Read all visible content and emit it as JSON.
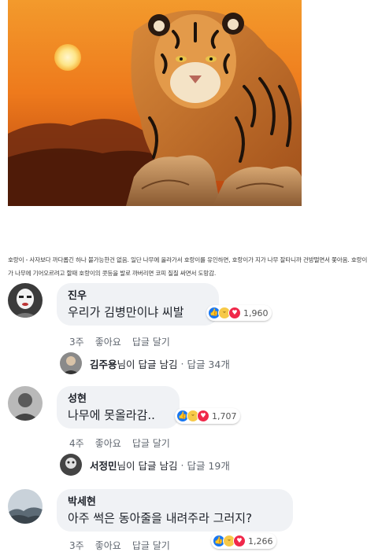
{
  "post": {
    "image_alt": "tiger-sunset-photo",
    "caption": "호랑이 - 사자보다 까다롭긴 하나 불가능한건 없음. 일단 나무에 올라가서 호랑이를 유인하면, 호랑이가 지가 나무 잘타니까 건방떨면서 쫓아옴. 호랑이가 나무에 기어오르려고 할때 호랑이의 콧등을 발로 까버리면 코피 질질 싸면서 도망감."
  },
  "comments": [
    {
      "author": "진우",
      "text": "우리가 김병만이냐 씨발",
      "reaction_count": "1,960",
      "time": "3주",
      "like_label": "좋아요",
      "reply_label": "답글 달기",
      "reply_summary": {
        "name": "김주용",
        "suffix": "님이 답글 남김",
        "separator": "·",
        "count": "답글 34개"
      }
    },
    {
      "author": "성현",
      "text": "나무에 못올라감..",
      "reaction_count": "1,707",
      "time": "4주",
      "like_label": "좋아요",
      "reply_label": "답글 달기",
      "reply_summary": {
        "name": "서정민",
        "suffix": "님이 답글 남김",
        "separator": "·",
        "count": "답글 19개"
      }
    },
    {
      "author": "박세현",
      "text": "아주 썩은 동아줄을 내려주라 그러지?",
      "reaction_count": "1,266",
      "time": "3주",
      "like_label": "좋아요",
      "reply_label": "답글 달기"
    }
  ],
  "reaction_icons": [
    "thumbs-up-icon",
    "haha-icon",
    "heart-icon"
  ],
  "colors": {
    "bubble_bg": "#f0f2f5",
    "like_blue": "#1877f2",
    "love_red": "#f0284a",
    "haha_yellow": "#f7c948",
    "meta_gray": "#606770"
  }
}
